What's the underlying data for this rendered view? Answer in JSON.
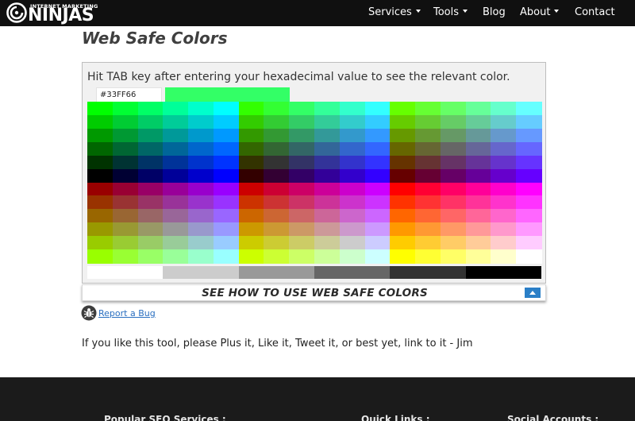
{
  "brand": {
    "tagline": "INTERNET MARKETING",
    "name": "NINJAS"
  },
  "nav": {
    "items": [
      {
        "label": "Services",
        "dropdown": true
      },
      {
        "label": "Tools",
        "dropdown": true
      },
      {
        "label": "Blog",
        "dropdown": false
      },
      {
        "label": "About",
        "dropdown": true
      },
      {
        "label": "Contact",
        "dropdown": false
      }
    ]
  },
  "page": {
    "title": "Web Safe Colors"
  },
  "tool": {
    "instructions": "Hit TAB key after entering your hexadecimal value to see the relevant color.",
    "hex_value": "#33FF66",
    "preview_color": "#33FF66",
    "howto_label": "SEE HOW TO USE WEB SAFE COLORS",
    "toggle_icon": "chevron-up-icon",
    "accent_color": "#2a7fc7",
    "grayscale": [
      "#ffffff",
      "#cccccc",
      "#999999",
      "#666666",
      "#333333",
      "#000000"
    ]
  },
  "report_bug": {
    "label": "Report a Bug",
    "icon": "bug-icon"
  },
  "cta": {
    "text": "If you like this tool, please Plus it, Like it, Tweet it, or best yet, link to it - Jim"
  },
  "footer": {
    "headings": [
      "Popular SEO Services :",
      "Quick Links :",
      "Social Accounts :"
    ]
  }
}
